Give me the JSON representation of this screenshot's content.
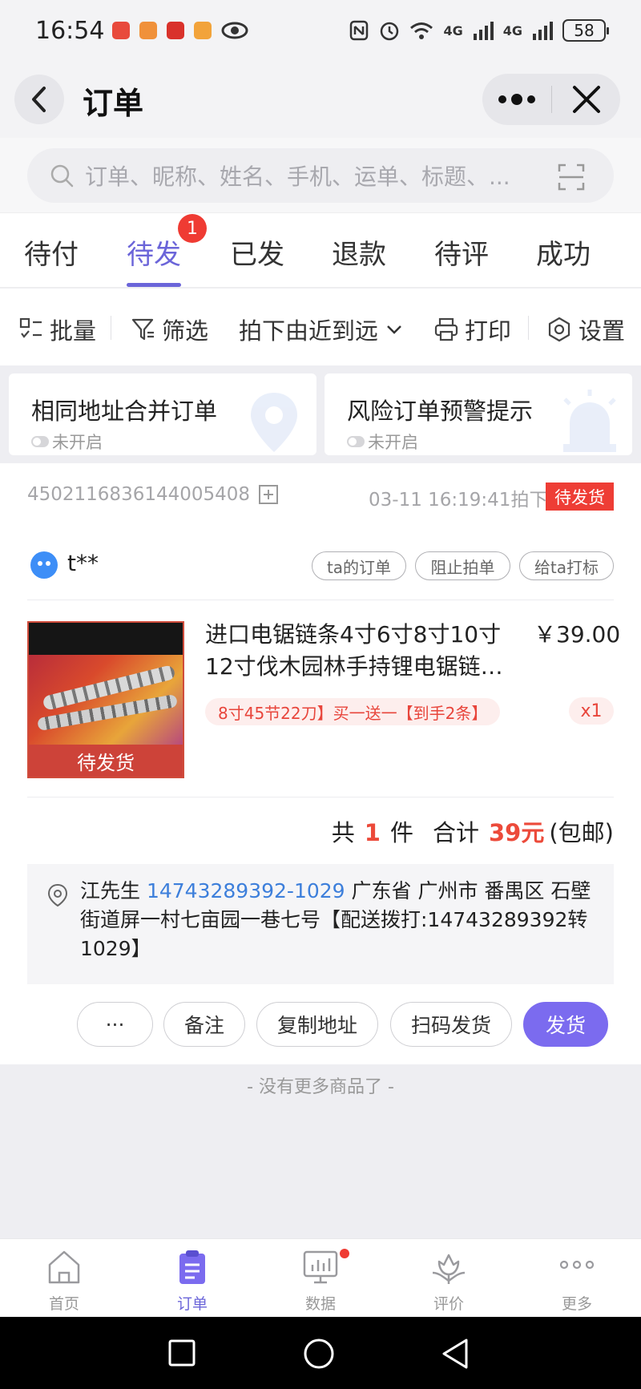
{
  "status_bar": {
    "time": "16:54",
    "signal_1": "4G",
    "signal_2": "4G",
    "battery": "58"
  },
  "nav": {
    "title": "订单"
  },
  "search": {
    "placeholder": "订单、昵称、姓名、手机、运单、标题、..."
  },
  "tabs": [
    {
      "label": "待付"
    },
    {
      "label": "待发",
      "badge": "1",
      "active": true
    },
    {
      "label": "已发"
    },
    {
      "label": "退款"
    },
    {
      "label": "待评"
    },
    {
      "label": "成功"
    }
  ],
  "toolbar": {
    "batch": "批量",
    "filter": "筛选",
    "sort": "拍下由近到远",
    "print": "打印",
    "settings": "设置"
  },
  "feature_cards": [
    {
      "title": "相同地址合并订单",
      "status": "未开启"
    },
    {
      "title": "风险订单预警提示",
      "status": "未开启"
    }
  ],
  "order": {
    "id": "4502116836144005408",
    "time": "03-11 16:19:41拍下",
    "status": "待发货",
    "buyer": "t**",
    "buyer_actions": [
      "ta的订单",
      "阻止拍单",
      "给ta打标"
    ],
    "product": {
      "title": "进口电锯链条4寸6寸8寸10寸12寸伐木园林手持锂电锯链…",
      "price": "￥39.00",
      "sku": "8寸45节22刀】买一送一【到手2条】",
      "qty": "x1",
      "image_overlay": "待发货"
    },
    "summary": {
      "count_prefix": "共",
      "count": "1",
      "count_suffix": "件",
      "total_label": "合计",
      "total": "39元",
      "shipping": "(包邮)"
    },
    "address": {
      "name": "江先生",
      "phone": "14743289392-1029",
      "detail": "广东省 广州市 番禺区 石壁街道屏一村七亩园一巷七号【配送拨打:14743289392转1029】"
    },
    "actions": {
      "more": "···",
      "note": "备注",
      "copy_address": "复制地址",
      "scan_ship": "扫码发货",
      "ship": "发货"
    }
  },
  "no_more_text": "- 没有更多商品了 -",
  "bottom_nav": [
    {
      "label": "首页",
      "icon": "home-icon"
    },
    {
      "label": "订单",
      "icon": "order-icon",
      "active": true
    },
    {
      "label": "数据",
      "icon": "data-icon",
      "dot": true
    },
    {
      "label": "评价",
      "icon": "review-icon"
    },
    {
      "label": "更多",
      "icon": "more-icon"
    }
  ],
  "colors": {
    "accent": "#6b65d9",
    "primary_button": "#7b6bef",
    "danger": "#ee3d35",
    "link": "#3d7fdb"
  }
}
